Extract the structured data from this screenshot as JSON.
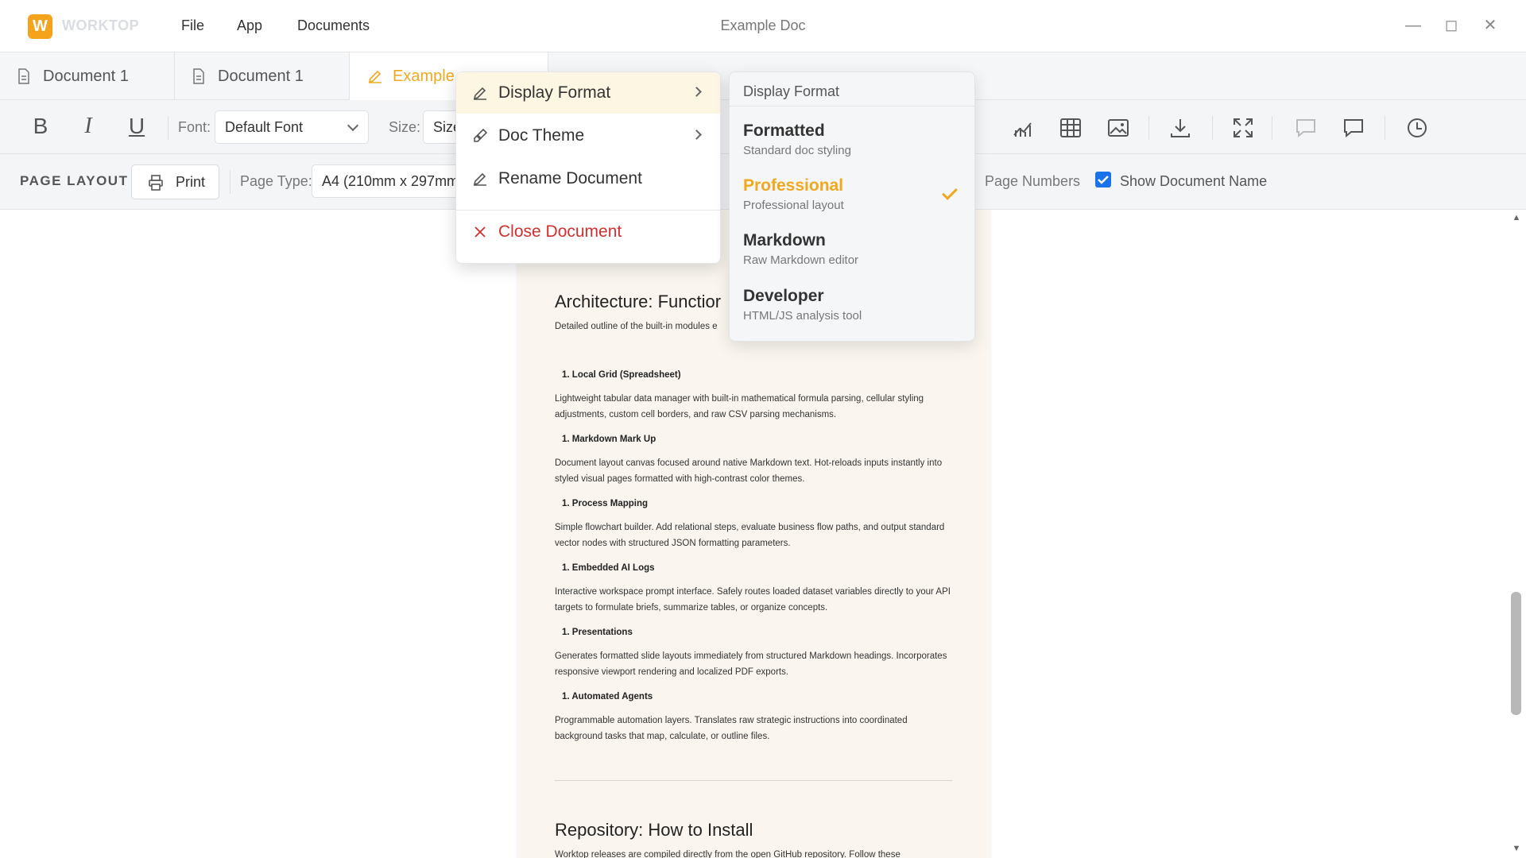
{
  "app": {
    "logo_letter": "W",
    "brand": "WORKTOP",
    "menu": [
      "File",
      "App",
      "Documents"
    ],
    "window_title": "Example Doc"
  },
  "tabs": [
    {
      "label": "Document 1",
      "icon": "document-icon"
    },
    {
      "label": "Document 1",
      "icon": "document-icon"
    },
    {
      "label": "Example",
      "icon": "edit-icon",
      "active": true
    }
  ],
  "toolbar": {
    "bold": "B",
    "italic": "I",
    "underline": "U",
    "font_label": "Font:",
    "font_value": "Default Font",
    "size_label": "Size:",
    "size_value": "Size"
  },
  "layout": {
    "title": "PAGE LAYOUT",
    "print_label": "Print",
    "page_type_label": "Page Type:",
    "page_type_value": "A4 (210mm x 297mm)",
    "page_numbers_label": "Page Numbers",
    "show_doc_name_label": "Show Document Name",
    "show_doc_name_checked": true
  },
  "context_menu": {
    "items": [
      {
        "label": "Display Format",
        "icon": "edit-icon",
        "submenu": true
      },
      {
        "label": "Doc Theme",
        "icon": "brush-icon",
        "submenu": true
      },
      {
        "label": "Rename Document",
        "icon": "edit-icon",
        "submenu": false
      },
      {
        "label": "Close Document",
        "icon": "close-icon",
        "submenu": false
      }
    ]
  },
  "submenu": {
    "heading": "Display Format",
    "options": [
      {
        "title": "Formatted",
        "desc": "Standard doc styling",
        "selected": false
      },
      {
        "title": "Professional",
        "desc": "Professional layout",
        "selected": true
      },
      {
        "title": "Markdown",
        "desc": "Raw Markdown editor",
        "selected": false
      },
      {
        "title": "Developer",
        "desc": "HTML/JS analysis tool",
        "selected": false
      }
    ]
  },
  "document": {
    "section1_title": "Architecture: Functior",
    "section1_sub": "Detailed outline of the built-in modules e",
    "items": [
      {
        "num": "1.",
        "title": "Local Grid (Spreadsheet)",
        "body": "Lightweight tabular data manager with built-in mathematical formula parsing, cellular styling adjustments, custom cell borders, and raw CSV parsing mechanisms."
      },
      {
        "num": "1.",
        "title": "Markdown Mark Up",
        "body": "Document layout canvas focused around native Markdown text. Hot-reloads inputs instantly into styled visual pages formatted with high-contrast color themes."
      },
      {
        "num": "1.",
        "title": "Process Mapping",
        "body": "Simple flowchart builder. Add relational steps, evaluate business flow paths, and output standard vector nodes with structured JSON formatting parameters."
      },
      {
        "num": "1.",
        "title": "Embedded AI Logs",
        "body": "Interactive workspace prompt interface. Safely routes loaded dataset variables directly to your API targets to formulate briefs, summarize tables, or organize concepts."
      },
      {
        "num": "1.",
        "title": "Presentations",
        "body": "Generates formatted slide layouts immediately from structured Markdown headings. Incorporates responsive viewport rendering and localized PDF exports."
      },
      {
        "num": "1.",
        "title": "Automated Agents",
        "body": "Programmable automation layers. Translates raw strategic instructions into coordinated background tasks that map, calculate, or outline files."
      }
    ],
    "section2_title": "Repository: How to Install",
    "section2_sub": "Worktop releases are compiled directly from the open GitHub repository. Follow these"
  },
  "colors": {
    "accent": "#f0a81e",
    "danger": "#d32f2f",
    "page_bg": "#faf6ef",
    "checkbox": "#1a73e8"
  }
}
